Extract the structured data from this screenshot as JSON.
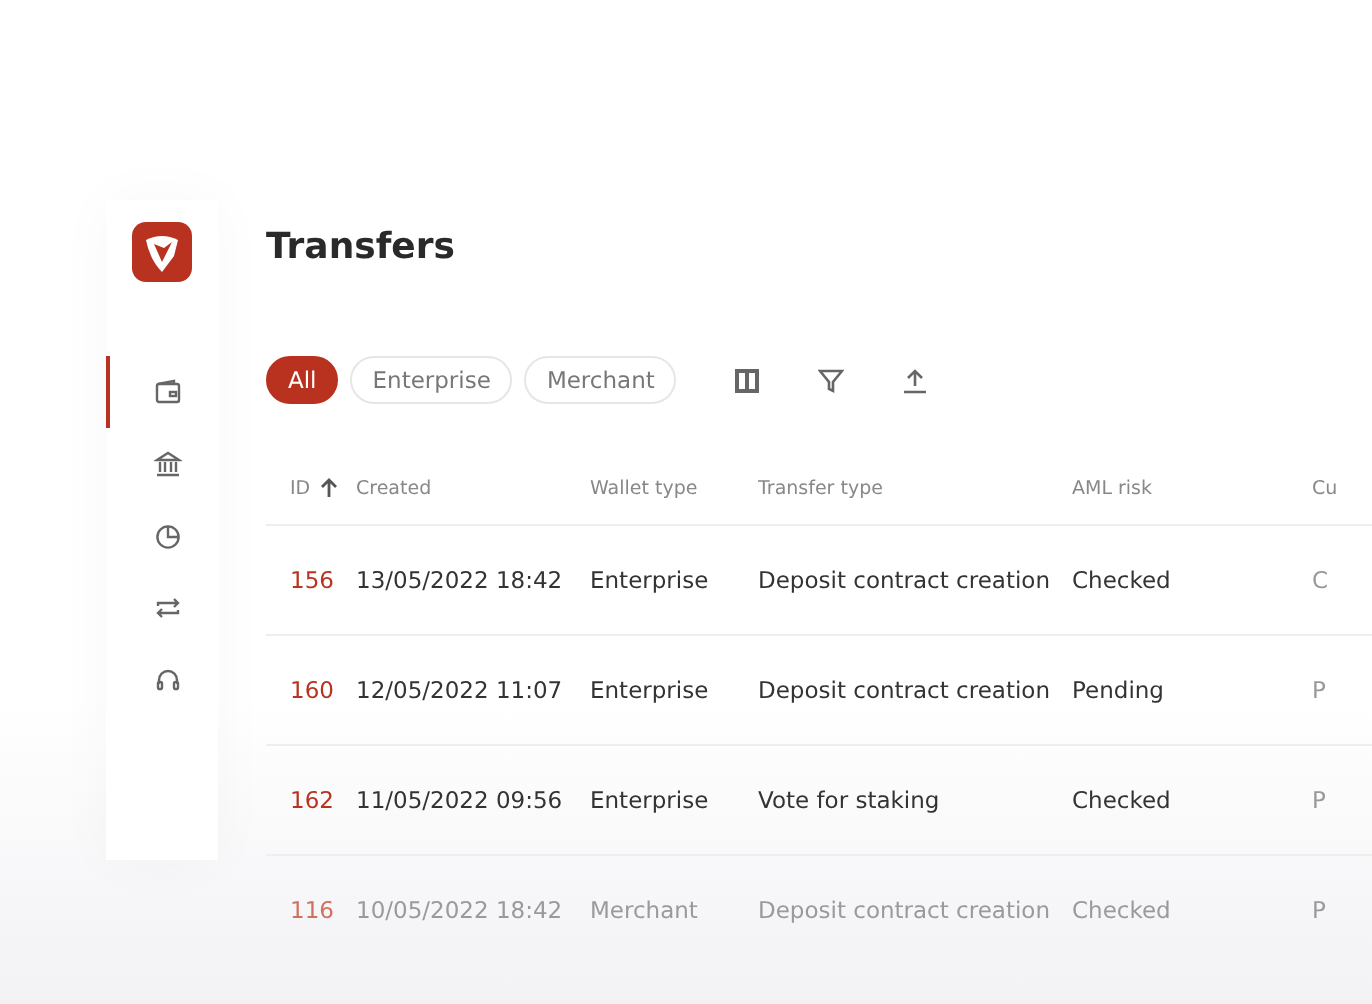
{
  "sidebar": {
    "items": [
      {
        "selected": true
      },
      {
        "selected": false
      },
      {
        "selected": false
      },
      {
        "selected": false
      },
      {
        "selected": false
      }
    ]
  },
  "title": "Transfers",
  "filters": [
    {
      "label": "All",
      "selected": true
    },
    {
      "label": "Enterprise",
      "selected": false
    },
    {
      "label": "Merchant",
      "selected": false
    }
  ],
  "table": {
    "columns": [
      {
        "label": "ID",
        "sorted": true
      },
      {
        "label": "Created",
        "sorted": false
      },
      {
        "label": "Wallet type",
        "sorted": false
      },
      {
        "label": "Transfer type",
        "sorted": false
      },
      {
        "label": "AML risk",
        "sorted": false
      },
      {
        "label": "Cu",
        "sorted": false
      }
    ],
    "rows": [
      {
        "faded": false,
        "cells": [
          "156",
          "13/05/2022 18:42",
          "Enterprise",
          "Deposit contract creation",
          "Checked",
          "C"
        ]
      },
      {
        "faded": false,
        "cells": [
          "160",
          "12/05/2022 11:07",
          "Enterprise",
          "Deposit contract creation",
          "Pending",
          "P"
        ]
      },
      {
        "faded": false,
        "cells": [
          "162",
          "11/05/2022 09:56",
          "Enterprise",
          "Vote for staking",
          "Checked",
          "P"
        ]
      },
      {
        "faded": true,
        "cells": [
          "116",
          "10/05/2022 18:42",
          "Merchant",
          "Deposit contract creation",
          "Checked",
          "P"
        ]
      }
    ]
  }
}
